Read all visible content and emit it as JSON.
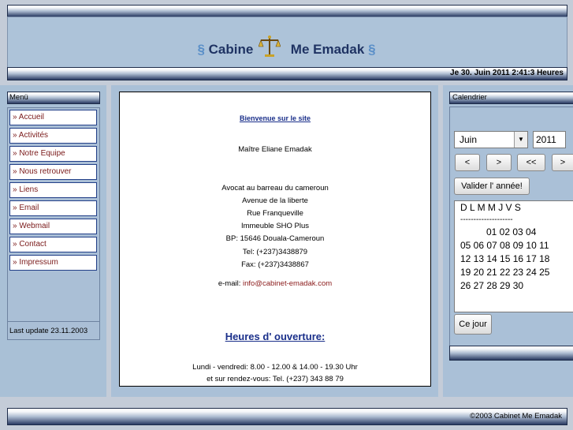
{
  "header": {
    "section_sign": "§",
    "title_left": "Cabine",
    "title_right": "Me Emadak",
    "datetime": "Je 30. Juin 2011 2:41:3 Heures"
  },
  "menu": {
    "title": "Menü",
    "items": [
      "» Accueil",
      "» Activités",
      "» Notre Equipe",
      "» Nous retrouver",
      "» Liens",
      "» Email",
      "» Webmail",
      "» Contact",
      "» Impressum"
    ],
    "last_update": "Last update 23.11.2003"
  },
  "content": {
    "welcome": "Bienvenue sur le site",
    "name": "Maître Eliane Emadak",
    "address": [
      "Avocat au barreau du cameroun",
      "Avenue de la liberte",
      "Rue Franqueville",
      "Immeuble SHO Plus",
      "BP: 15646 Douala-Cameroun",
      "Tel: (+237)3438879",
      "Fax: (+237)3438867"
    ],
    "email_label": "e-mail:",
    "email": "info@cabinet-emadak.com",
    "hours_title": "Heures d' ouverture:",
    "hours_line1": "Lundi - vendredi: 8.00 - 12.00 & 14.00 - 19.30 Uhr",
    "hours_line2": "et sur rendez-vous: Tel. (+237) 343 88 79"
  },
  "calendar": {
    "title": "Calendrier",
    "month": "Juin",
    "year": "2011",
    "btn_prev": "<",
    "btn_next": ">",
    "btn_prev_year": "<<",
    "btn_next_year": ">",
    "validate_year": "Valider l' année!",
    "days_header": "D L M M J V S",
    "separator": "--------------------",
    "weeks": [
      "01 02 03 04",
      "05 06 07 08 09 10 11",
      "12 13 14 15 16 17 18",
      "19 20 21 22 23 24 25",
      "26 27 28 29 30"
    ],
    "today_button": "Ce jour"
  },
  "footer": {
    "copyright": "©2003 Cabinet Me Emadak"
  }
}
